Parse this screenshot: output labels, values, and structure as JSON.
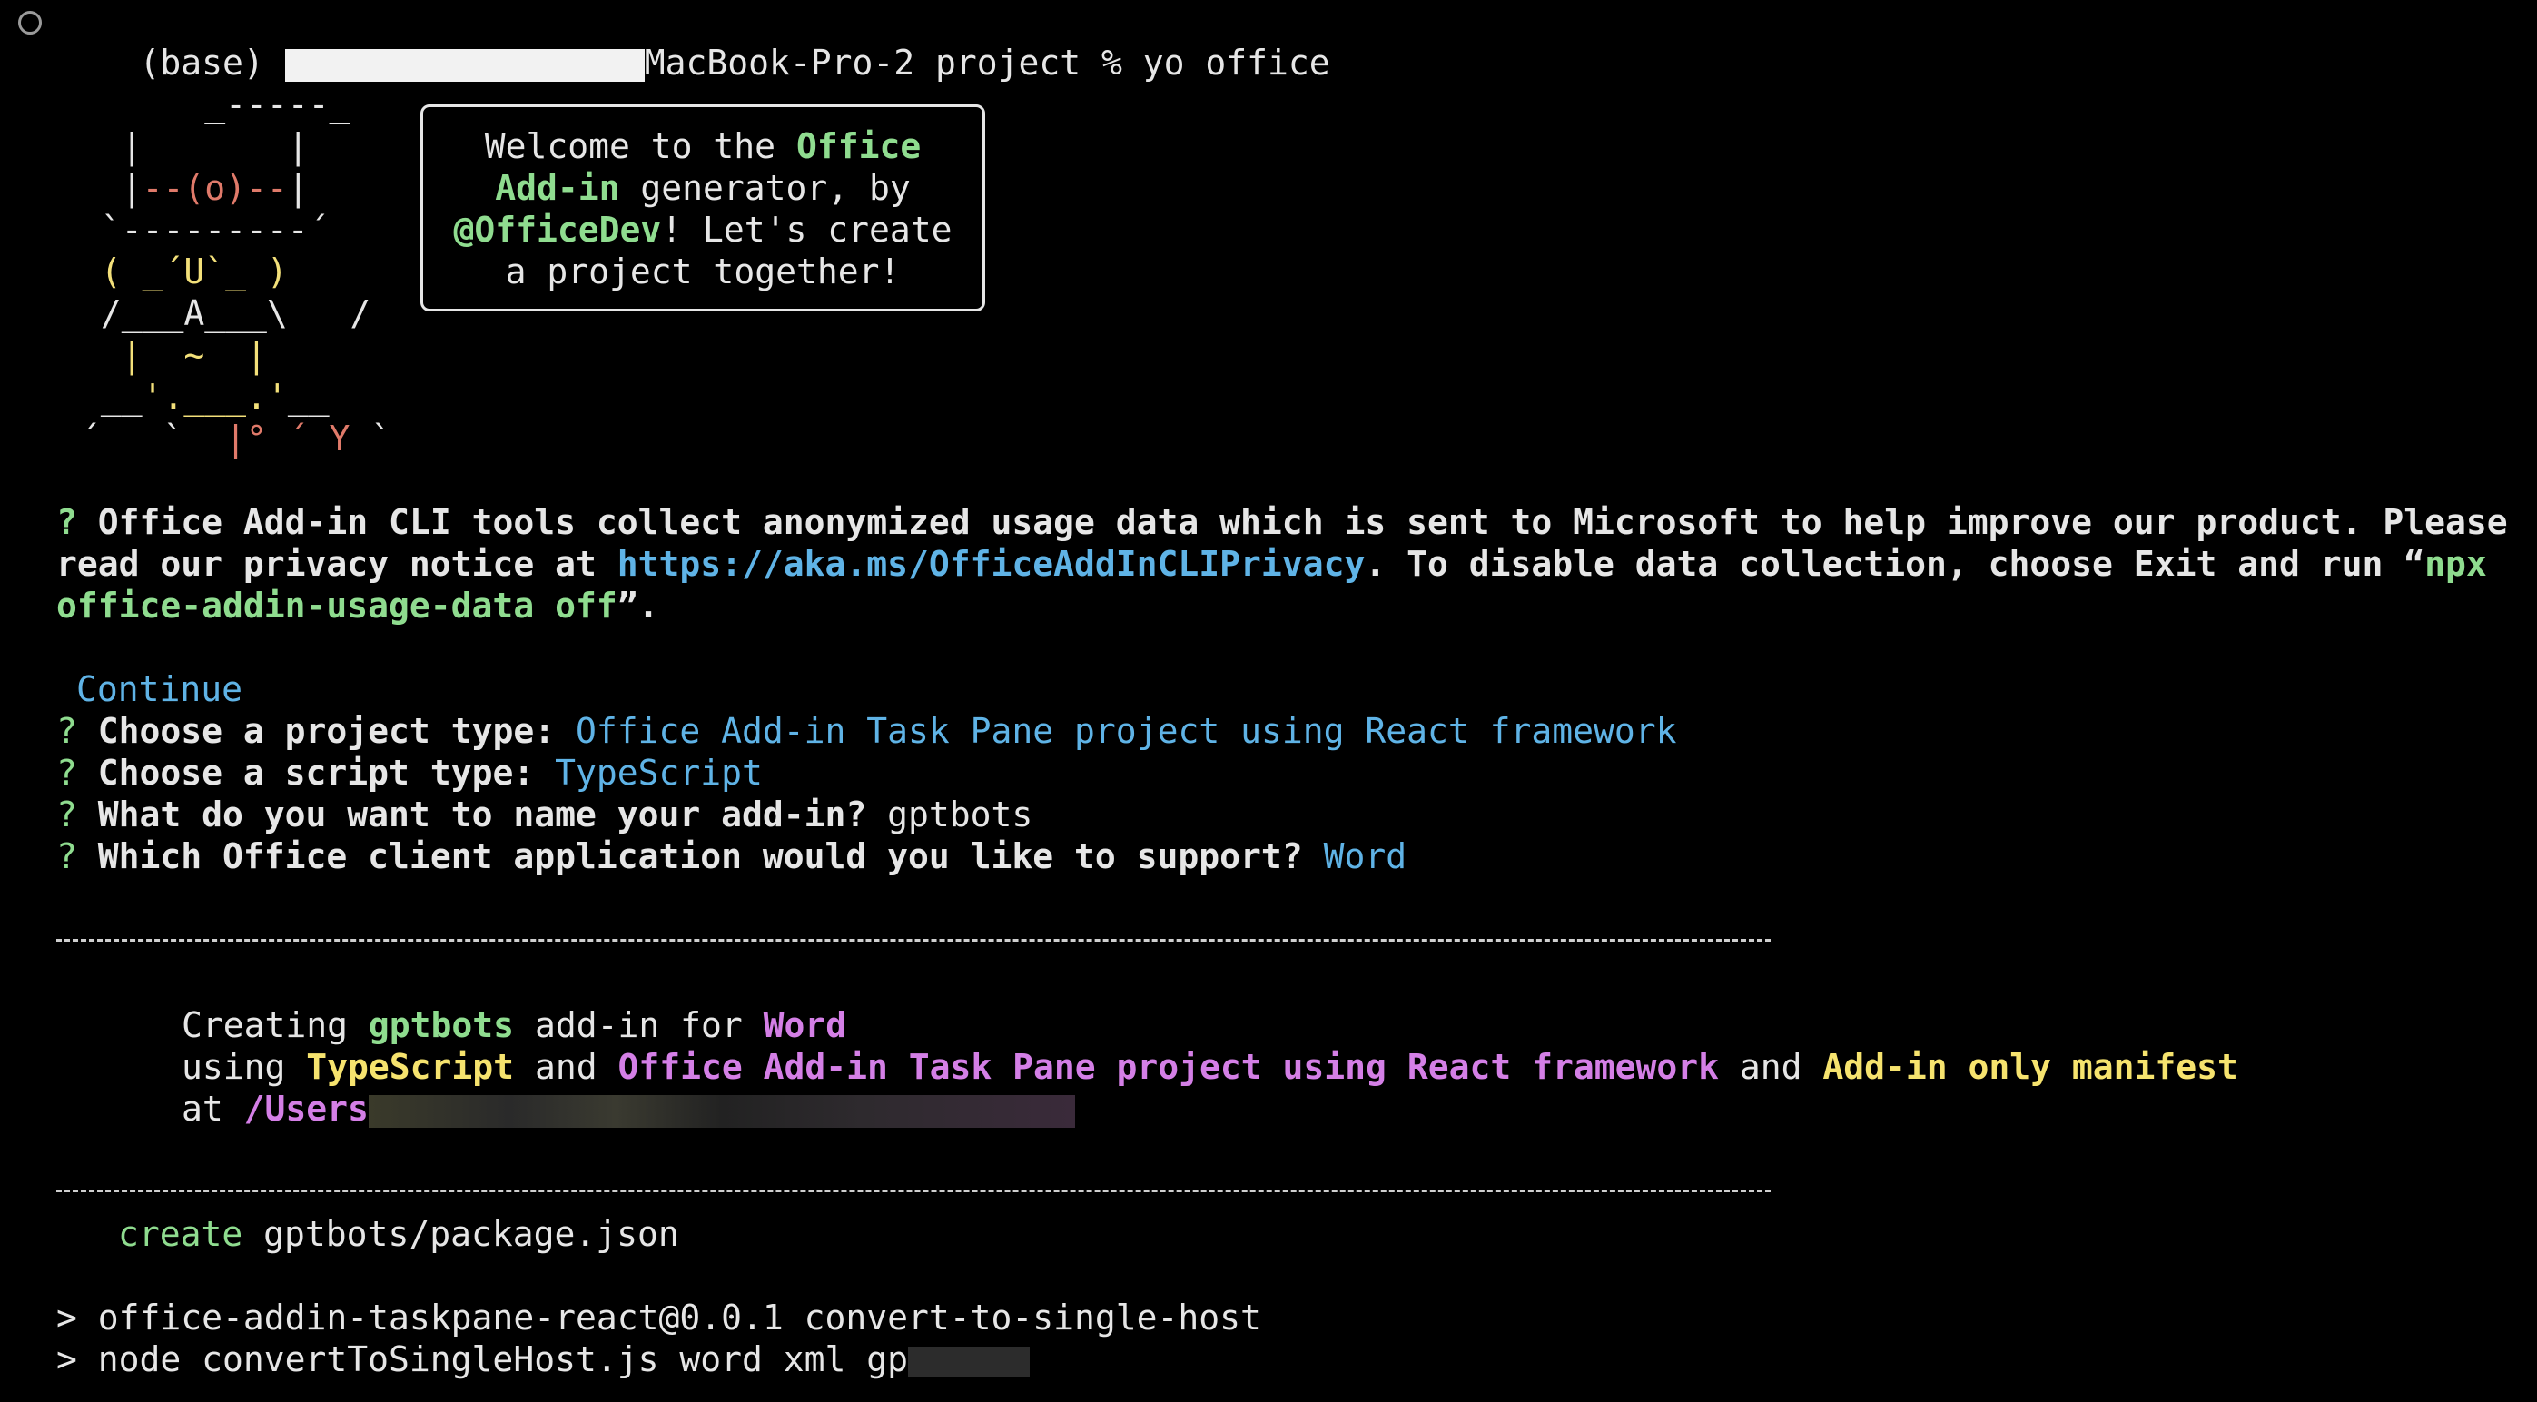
{
  "shell": {
    "env": "(base)",
    "host_suffix": "MacBook-Pro-2 project % yo office"
  },
  "ascii_art": {
    "line1": "_-----_",
    "line2a": "|       |",
    "line3a": "|",
    "line3b": "--(o)--",
    "line3c": "|",
    "line4": "`---------´",
    "line5": "( _´U`_ )",
    "line6": "/___A___\\   /",
    "line7": "|  ~  |",
    "line8a": "__",
    "line8b": "'.___.'",
    "line8c": "__",
    "line9a": "´   `  ",
    "line9b": "|° ´ Y",
    "line9c": " `"
  },
  "welcome": {
    "l1_pre": "Welcome to the ",
    "l1_hl": "Office",
    "l2_hl": "Add-in",
    "l2_post": " generator, by",
    "l3_hl": "@OfficeDev",
    "l3_post": "! Let's create",
    "l4": "a project together!"
  },
  "privacy": {
    "q": "?",
    "l1": " Office Add-in CLI tools collect anonymized usage data which is sent to Microsoft to help improve our product. Please",
    "l2_pre": "read our privacy notice at ",
    "link": "https://aka.ms/OfficeAddInCLIPrivacy",
    "l2_post": ". To disable data collection, choose Exit and run “",
    "cmd1": "npx",
    "cmd2": "office-addin-usage-data off",
    "l3_post": "”."
  },
  "continue_label": "Continue",
  "answers": [
    {
      "question": "Choose a project type:",
      "answer": "Office Add-in Task Pane project using React framework"
    },
    {
      "question": "Choose a script type:",
      "answer": "TypeScript"
    },
    {
      "question": "What do you want to name your add-in?",
      "answer": "gptbots"
    },
    {
      "question": "Which Office client application would you like to support?",
      "answer": "Word"
    }
  ],
  "summary": {
    "creating": "Creating ",
    "name": "gptbots",
    "addin_for": " add-in for ",
    "host": "Word",
    "using": "using ",
    "script": "TypeScript",
    "and1": " and ",
    "project": "Office Add-in Task Pane project using React framework",
    "and2": " and ",
    "manifest": "Add-in only manifest",
    "at": "at ",
    "path": "/Users"
  },
  "create_line": {
    "verb": "create",
    "file": "gptbots/package.json"
  },
  "npm_lines": [
    "> office-addin-taskpane-react@0.0.1 convert-to-single-host",
    "> node convertToSingleHost.js word xml gp"
  ],
  "colors": {
    "background": "#000000",
    "text": "#e6e6e6",
    "green": "#8fdc8f",
    "cyan": "#5fb3e6",
    "yellow": "#f6e36e",
    "magenta": "#d47fe6",
    "red": "#e07a6a"
  }
}
